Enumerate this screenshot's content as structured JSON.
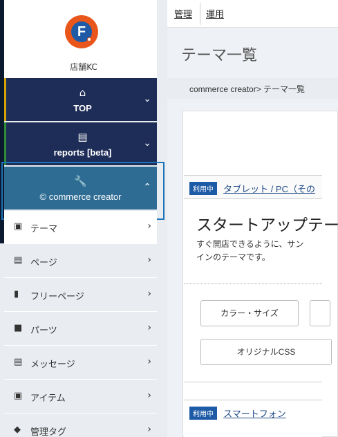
{
  "store": {
    "name": "店舗KC"
  },
  "nav": {
    "top": {
      "label": "TOP"
    },
    "reports": {
      "label": "reports [beta]"
    },
    "commerce_creator": {
      "label": "commerce creator"
    }
  },
  "submenu": [
    {
      "label": "テーマ",
      "icon": "image-icon"
    },
    {
      "label": "ページ",
      "icon": "pages-icon"
    },
    {
      "label": "フリーページ",
      "icon": "document-icon"
    },
    {
      "label": "パーツ",
      "icon": "briefcase-icon"
    },
    {
      "label": "メッセージ",
      "icon": "message-icon"
    },
    {
      "label": "アイテム",
      "icon": "picture-icon"
    },
    {
      "label": "管理タグ",
      "icon": "tag-icon"
    }
  ],
  "topnav": {
    "manage": "管理",
    "operate": "運用"
  },
  "page": {
    "title": "テーマ一覧",
    "breadcrumb": "commerce creator> テーマ一覧"
  },
  "cards": [
    {
      "badge": "利用中",
      "link": "タブレット / PC（その",
      "title": "スタートアップテー",
      "desc": "すぐ開店できるように、サン\nインのテーマです。",
      "buttons": {
        "color_size": "カラー・サイズ",
        "original_css": "オリジナルCSS"
      }
    },
    {
      "badge": "利用中",
      "link": "スマートフォン"
    }
  ],
  "colors": {
    "nav_dark": "#1e2d57",
    "nav_active": "#2e6c94",
    "badge": "#1e5ba6",
    "logo_orange": "#e8561c"
  }
}
